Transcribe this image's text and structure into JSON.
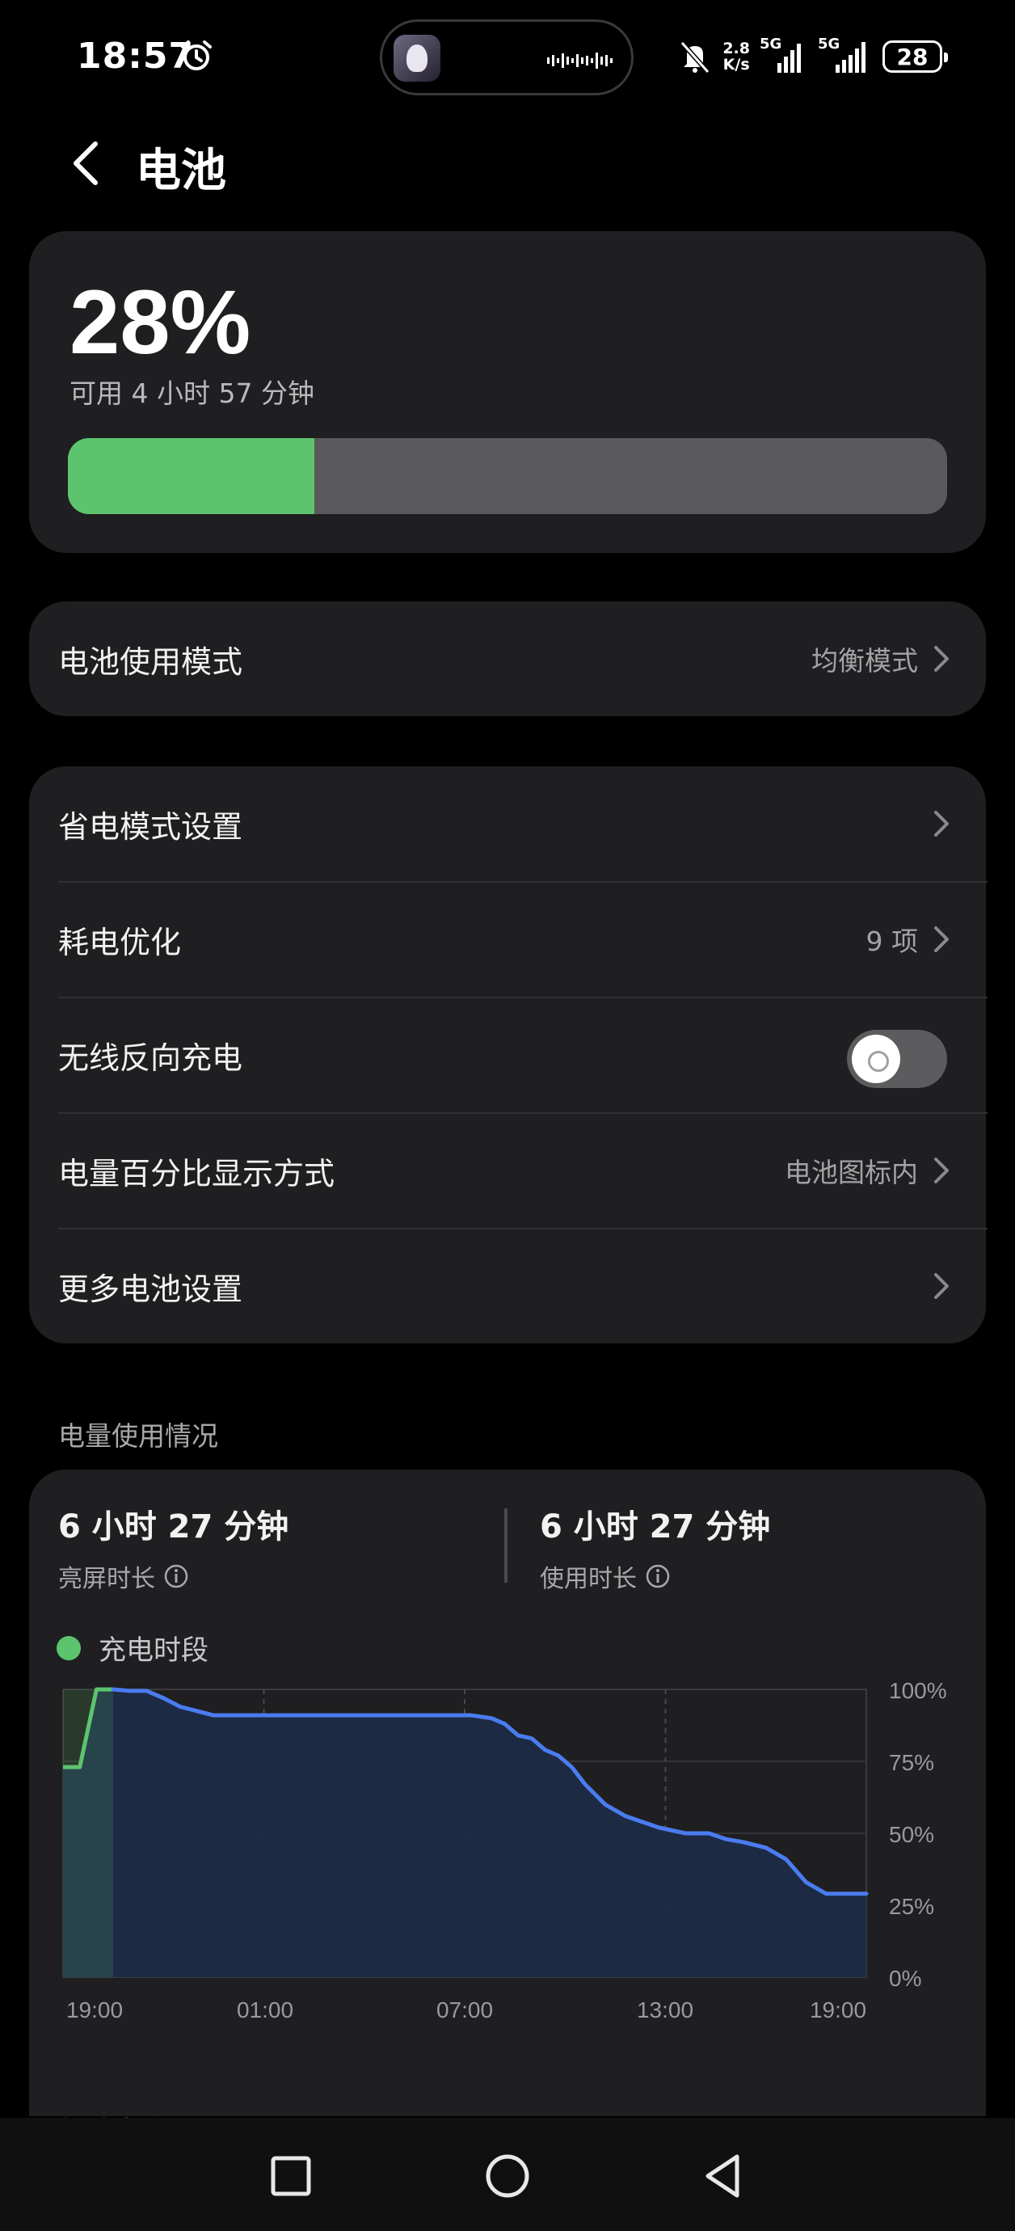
{
  "status_bar": {
    "time": "18:57",
    "net_speed_value": "2.8",
    "net_speed_unit": "K/s",
    "sim1": "5G",
    "sim2": "5G",
    "battery": "28"
  },
  "header": {
    "title": "电池"
  },
  "summary": {
    "percent_text": "28%",
    "remaining": "可用 4 小时 57 分钟",
    "level": 0.28,
    "fill_color": "#5dc46e"
  },
  "mode_row": {
    "label": "电池使用模式",
    "value": "均衡模式"
  },
  "settings": {
    "power_saving": "省电模式设置",
    "optimization": "耗电优化",
    "optimization_value": "9 项",
    "reverse_charge": "无线反向充电",
    "reverse_charge_on": false,
    "percent_display": "电量百分比显示方式",
    "percent_display_value": "电池图标内",
    "more": "更多电池设置"
  },
  "usage": {
    "section_title": "电量使用情况",
    "screen_on_value": "6 小时 27 分钟",
    "screen_on_label": "亮屏时长",
    "usage_value": "6 小时 27 分钟",
    "usage_label": "使用时长",
    "legend_charging": "充电时段",
    "next_section": "耗电排行"
  },
  "chart_data": {
    "type": "area",
    "x_tick_labels": [
      "19:00",
      "01:00",
      "07:00",
      "13:00",
      "19:00"
    ],
    "y_tick_labels": [
      "100%",
      "75%",
      "50%",
      "25%",
      "0%"
    ],
    "ylim": [
      0,
      100
    ],
    "x_hours": [
      0,
      0.5,
      1.0,
      1.5,
      2.0,
      2.5,
      3.0,
      3.5,
      4.5,
      6,
      8,
      10,
      11.5,
      12.2,
      12.8,
      13.2,
      13.6,
      14.0,
      14.4,
      14.8,
      15.2,
      15.6,
      16.2,
      16.8,
      17.3,
      17.8,
      18.6,
      19.3,
      19.8,
      20.3,
      21.0,
      21.6,
      22.2,
      22.8,
      23.4,
      24.0
    ],
    "values": [
      73,
      73,
      100,
      100,
      99.5,
      99.5,
      97,
      94,
      91,
      91,
      91,
      91,
      91,
      91,
      90,
      88,
      84,
      83,
      79,
      77,
      73,
      67,
      60,
      56,
      54,
      52,
      50,
      50,
      48,
      47,
      45,
      41,
      33,
      29,
      29,
      29
    ],
    "charging_until_hour": 1.5,
    "line_color": "#4a7cf0",
    "charging_color": "#5dc46e"
  },
  "nav": {
    "recent": "square-icon",
    "home": "circle-icon",
    "back": "triangle-icon"
  }
}
